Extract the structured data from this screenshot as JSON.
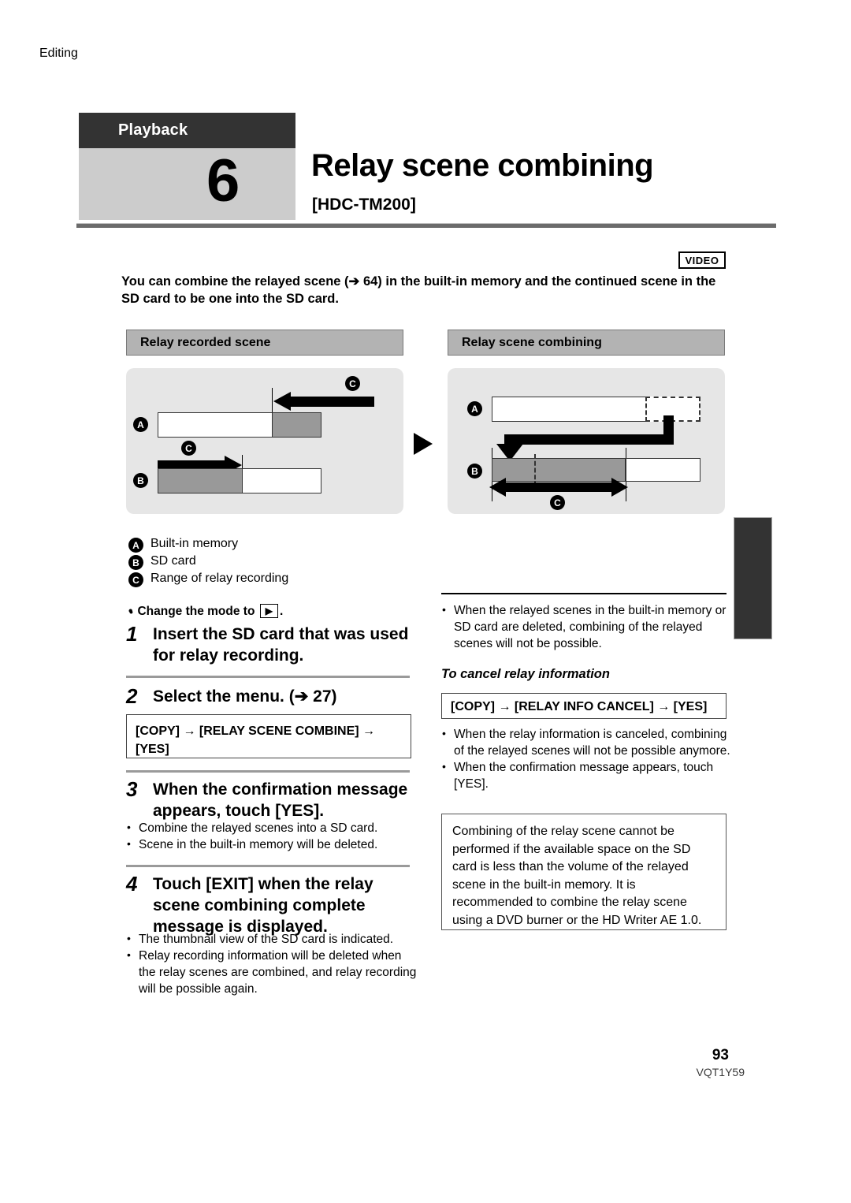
{
  "header": {
    "chapter": "Playback",
    "section": "Editing",
    "number": "6",
    "title": "Relay scene combining",
    "model": "[HDC-TM200]"
  },
  "badges": {
    "video": "VIDEO"
  },
  "intro": "You can combine the relayed scene (➔ 64) in the built-in memory and the continued scene in the SD card to be one into the SD card.",
  "diagrams": {
    "left": {
      "caption": "Relay recorded scene"
    },
    "right": {
      "caption": "Relay scene combining"
    },
    "markers": {
      "a": "A",
      "b": "B",
      "c": "C"
    }
  },
  "legend": [
    {
      "marker": "A",
      "text": "Built-in memory"
    },
    {
      "marker": "B",
      "text": "SD card"
    },
    {
      "marker": "C",
      "text": "Range of relay recording"
    }
  ],
  "left_column": {
    "mode_note_prefix": "Change the mode to",
    "mode_note_icon": "▶",
    "mode_note_suffix": ".",
    "steps": [
      {
        "num": "1",
        "text": "Insert the SD card that was used for relay recording."
      },
      {
        "num": "2",
        "text": "Select the menu. (➔ 27)"
      },
      {
        "num": "3",
        "text": "When the confirmation message appears, touch [YES]."
      },
      {
        "num": "4",
        "text": "Touch [EXIT] when the relay scene combining complete message is displayed."
      }
    ],
    "menu_path_combine": "[COPY] → [RELAY SCENE COMBINE] → [YES]",
    "step3_bullets": [
      "Combine the relayed scenes into a SD card.",
      "Scene in the built-in memory will be deleted."
    ],
    "step4_bullets": [
      "The thumbnail view of the SD card is indicated.",
      "Relay recording information will be deleted when the relay scenes are combined, and relay recording will be possible again."
    ]
  },
  "right_column": {
    "bullet_top": "When the relayed scenes in the built-in memory or SD card are deleted, combining of the relayed scenes will not be possible.",
    "subheading": "To cancel relay information",
    "menu_path_cancel": "[COPY] → [RELAY INFO CANCEL] → [YES]",
    "bullets": [
      "When the relay information is canceled, combining of the relayed scenes will not be possible anymore.",
      "When the confirmation message appears, touch [YES]."
    ],
    "note_box": "Combining of the relay scene cannot be performed if the available space on the SD card is less than the volume of the relayed scene in the built-in memory. It is recommended to combine the relay scene using a DVD burner or the HD Writer AE 1.0."
  },
  "footer": {
    "page_number": "93",
    "doc_code": "VQT1Y59"
  },
  "colors": {
    "chapter_bar": "#333333",
    "section_band": "#cccccc",
    "rule": "#6b6b6b",
    "panel": "#e6e6e6",
    "caption": "#b3b3b3",
    "bar_gray": "#999999"
  }
}
